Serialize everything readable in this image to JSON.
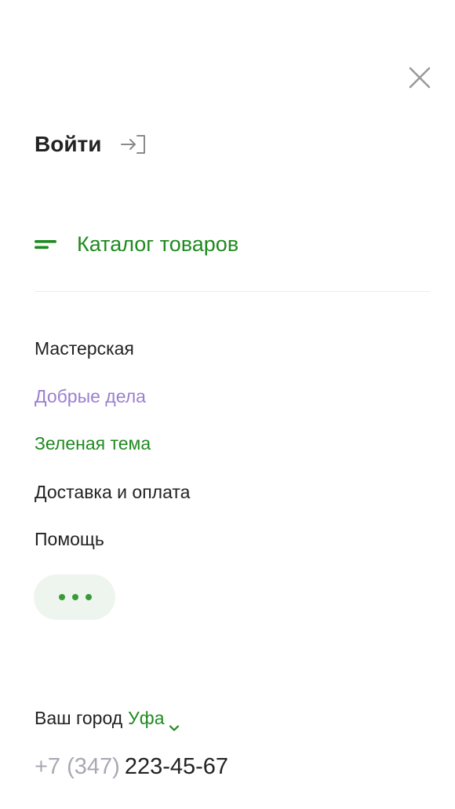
{
  "header": {
    "close_icon": "close-icon"
  },
  "login": {
    "label": "Войти",
    "icon": "login-icon"
  },
  "catalog": {
    "label": "Каталог товаров",
    "icon": "menu-lines-icon",
    "color": "#1f8a1f"
  },
  "menu": {
    "items": [
      {
        "label": "Мастерская",
        "color": "#222222"
      },
      {
        "label": "Добрые дела",
        "color": "#9b7fd0"
      },
      {
        "label": "Зеленая тема",
        "color": "#1f8a1f"
      },
      {
        "label": "Доставка и оплата",
        "color": "#222222"
      },
      {
        "label": "Помощь",
        "color": "#222222"
      }
    ],
    "more_icon": "more-dots-icon"
  },
  "city": {
    "label": "Ваш город",
    "value": "Уфа",
    "icon": "chevron-down-icon"
  },
  "phone": {
    "prefix": "+7 (347)",
    "number": "223-45-67"
  },
  "colors": {
    "accent": "#1f8a1f",
    "purple": "#9b7fd0",
    "muted": "#a8a8b4",
    "text": "#222222"
  }
}
